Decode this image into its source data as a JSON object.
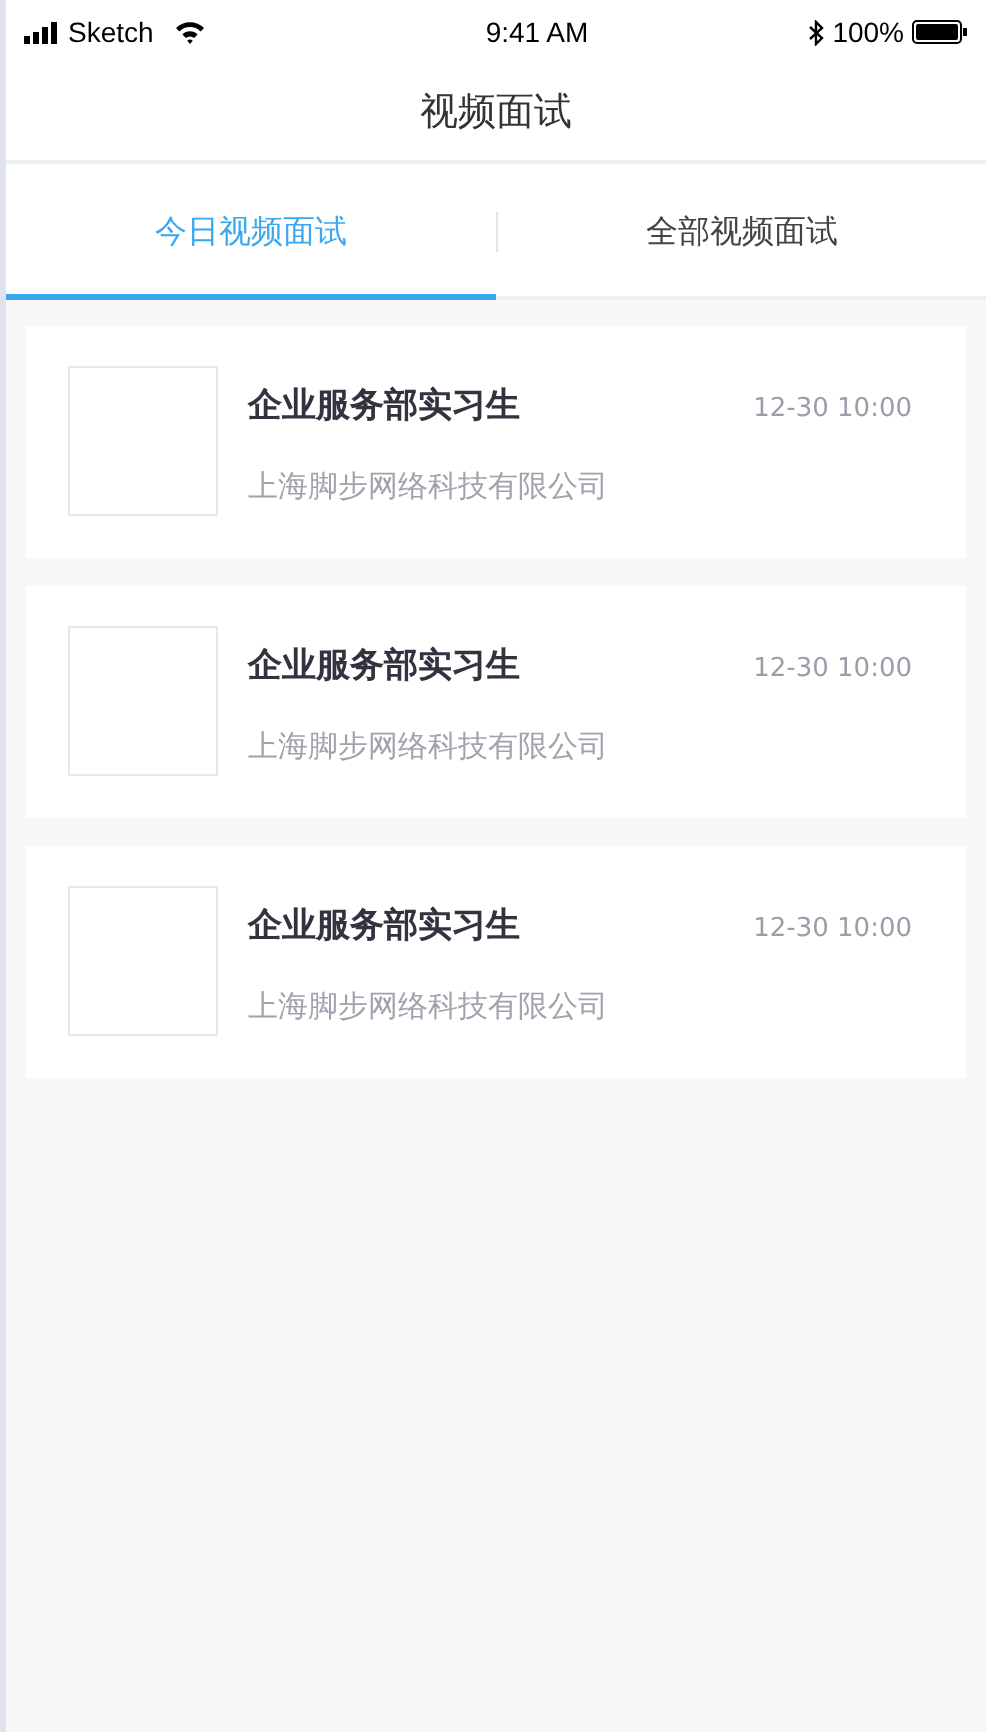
{
  "status_bar": {
    "carrier": "Sketch",
    "time": "9:41 AM",
    "battery": "100%"
  },
  "title": "视频面试",
  "tabs": [
    {
      "label": "今日视频面试",
      "selected": true
    },
    {
      "label": "全部视频面试",
      "selected": false
    }
  ],
  "interviews": [
    {
      "position": "企业服务部实习生",
      "company": "上海脚步网络科技有限公司",
      "time": "12-30 10:00"
    },
    {
      "position": "企业服务部实习生",
      "company": "上海脚步网络科技有限公司",
      "time": "12-30 10:00"
    },
    {
      "position": "企业服务部实习生",
      "company": "上海脚步网络科技有限公司",
      "time": "12-30 10:00"
    }
  ]
}
